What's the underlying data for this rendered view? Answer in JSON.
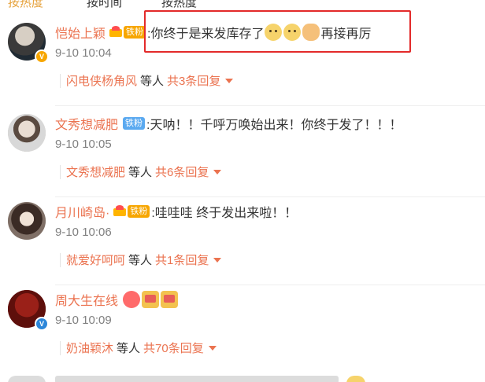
{
  "top_tabs": [
    {
      "label": "按热度"
    },
    {
      "label": "按时间"
    },
    {
      "label": "按热度"
    }
  ],
  "comments": [
    {
      "user": "恺始上颖",
      "fan_badge": "铁粉",
      "text_before": ":你终于是来发库存了",
      "text_after": "再接再厉",
      "emojis": [
        "doge-icon",
        "doge-icon",
        "pray-icon"
      ],
      "time": "9-10 10:04",
      "reply_user": "闪电侠杨角风",
      "reply_mid": "等人",
      "reply_count": "共3条回复"
    },
    {
      "user": "文秀想减肥",
      "fan_badge": "铁粉",
      "text_before": ":天呐！！千呼万唤始出来！你终于发了！！！",
      "time": "9-10 10:05",
      "reply_user": "文秀想减肥",
      "reply_mid": "等人",
      "reply_count": "共6条回复"
    },
    {
      "user": "月川崎岛·",
      "fan_badge": "铁粉",
      "text_before": ":哇哇哇 终于发出来啦！！",
      "time": "9-10 10:06",
      "reply_user": "就爱好呵呵",
      "reply_mid": "等人",
      "reply_count": "共1条回复"
    },
    {
      "user": "周大生在线",
      "emojis": [
        "heart-icon",
        "cheer-icon",
        "cheer-icon"
      ],
      "time": "9-10 10:09",
      "reply_user": "奶油颖沐",
      "reply_mid": "等人",
      "reply_count": "共70条回复"
    }
  ],
  "colors": {
    "username": "#eb7350",
    "time": "#808080",
    "highlight_border": "#e32a2a"
  }
}
